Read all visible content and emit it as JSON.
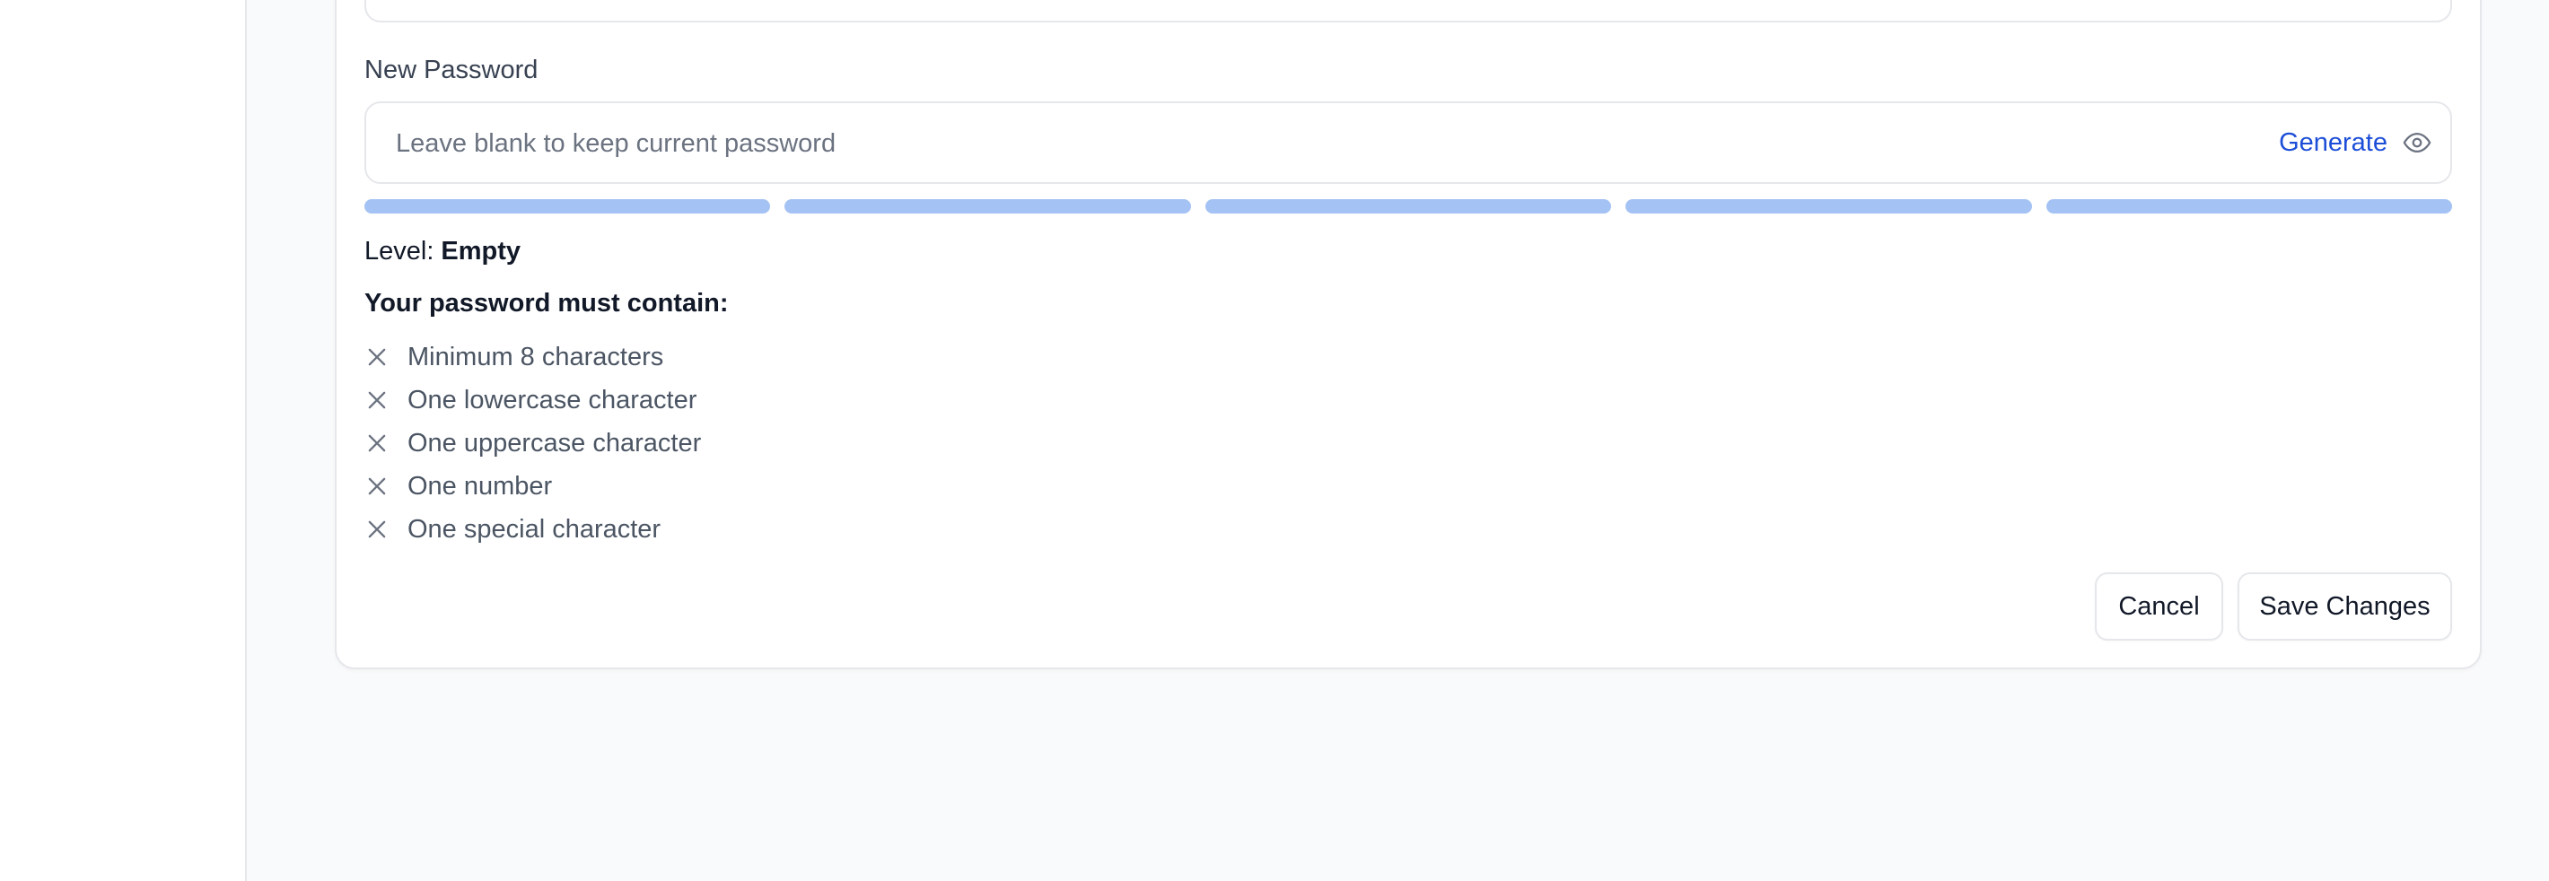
{
  "form": {
    "new_password_label": "New Password",
    "new_password_input": {
      "value": "",
      "placeholder": "Leave blank to keep current password"
    },
    "generate_label": "Generate",
    "show_password_icon": "eye-icon",
    "strength": {
      "segments": 5,
      "level_label": "Level:",
      "level_value": "Empty",
      "bar_color": "#a4c2f4"
    },
    "requirements_title": "Your password must contain:",
    "requirements": [
      {
        "label": "Minimum 8 characters",
        "met": false,
        "icon": "x-icon"
      },
      {
        "label": "One lowercase character",
        "met": false,
        "icon": "x-icon"
      },
      {
        "label": "One uppercase character",
        "met": false,
        "icon": "x-icon"
      },
      {
        "label": "One number",
        "met": false,
        "icon": "x-icon"
      },
      {
        "label": "One special character",
        "met": false,
        "icon": "x-icon"
      }
    ],
    "cancel_label": "Cancel",
    "save_label": "Save Changes"
  },
  "colors": {
    "link": "#1d4ed8",
    "border": "#e5e7eb",
    "page_bg": "#f9fafb",
    "muted_text": "#4b5563"
  }
}
